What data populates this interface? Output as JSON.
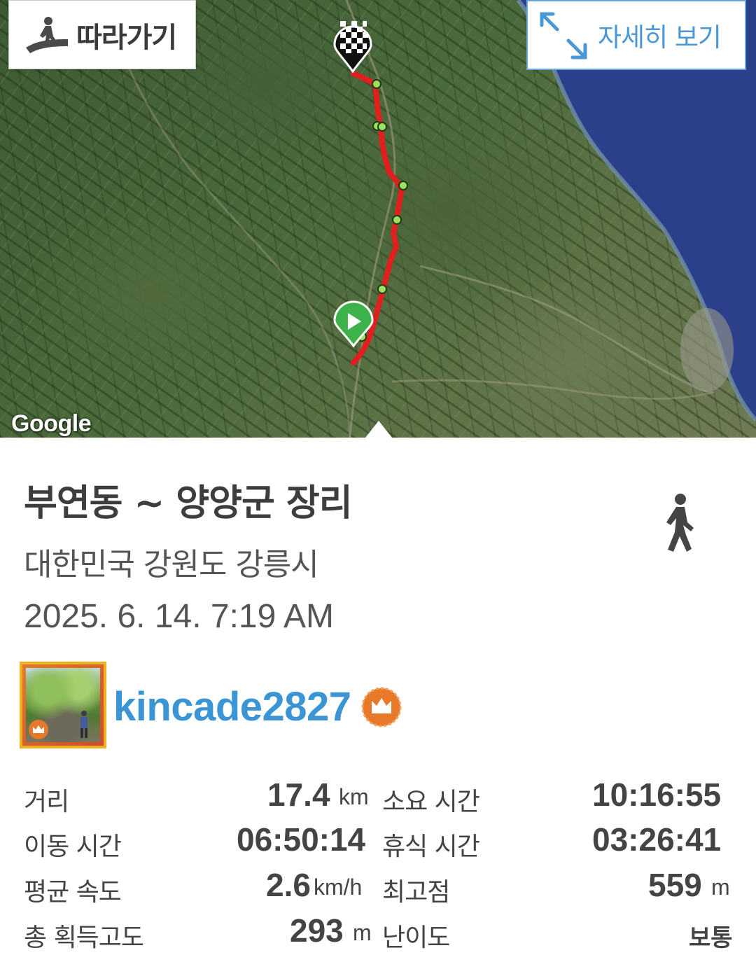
{
  "map": {
    "provider_logo": "Google",
    "follow_button": {
      "label": "따라가기",
      "icon": "hiker-on-trail-icon"
    },
    "detail_button": {
      "label": "자세히 보기",
      "icon": "expand-arrows-icon"
    },
    "track_color": "#e01f1f",
    "start_marker": "play-marker-icon",
    "end_marker": "checkered-flag-marker-icon"
  },
  "trip": {
    "title": "부연동 ~ 양양군 장리",
    "location": "대한민국 강원도 강릉시",
    "datetime": "2025. 6. 14. 7:19 AM",
    "activity_icon": "walking-person-icon"
  },
  "user": {
    "name": "kincade2827",
    "badge": "crown-badge-icon",
    "accent": "#3b95d4"
  },
  "stats": {
    "distance": {
      "label": "거리",
      "value": "17.4",
      "unit": "km"
    },
    "total_time": {
      "label": "소요 시간",
      "value": "10:16:55",
      "unit": ""
    },
    "moving_time": {
      "label": "이동 시간",
      "value": "06:50:14",
      "unit": ""
    },
    "rest_time": {
      "label": "휴식 시간",
      "value": "03:26:41",
      "unit": ""
    },
    "avg_speed": {
      "label": "평균 속도",
      "value": "2.6",
      "unit": "km/h"
    },
    "max_elev": {
      "label": "최고점",
      "value": "559",
      "unit": "m"
    },
    "total_gain": {
      "label": "총 획득고도",
      "value": "293",
      "unit": "m"
    },
    "difficulty": {
      "label": "난이도",
      "value": "보통"
    }
  }
}
